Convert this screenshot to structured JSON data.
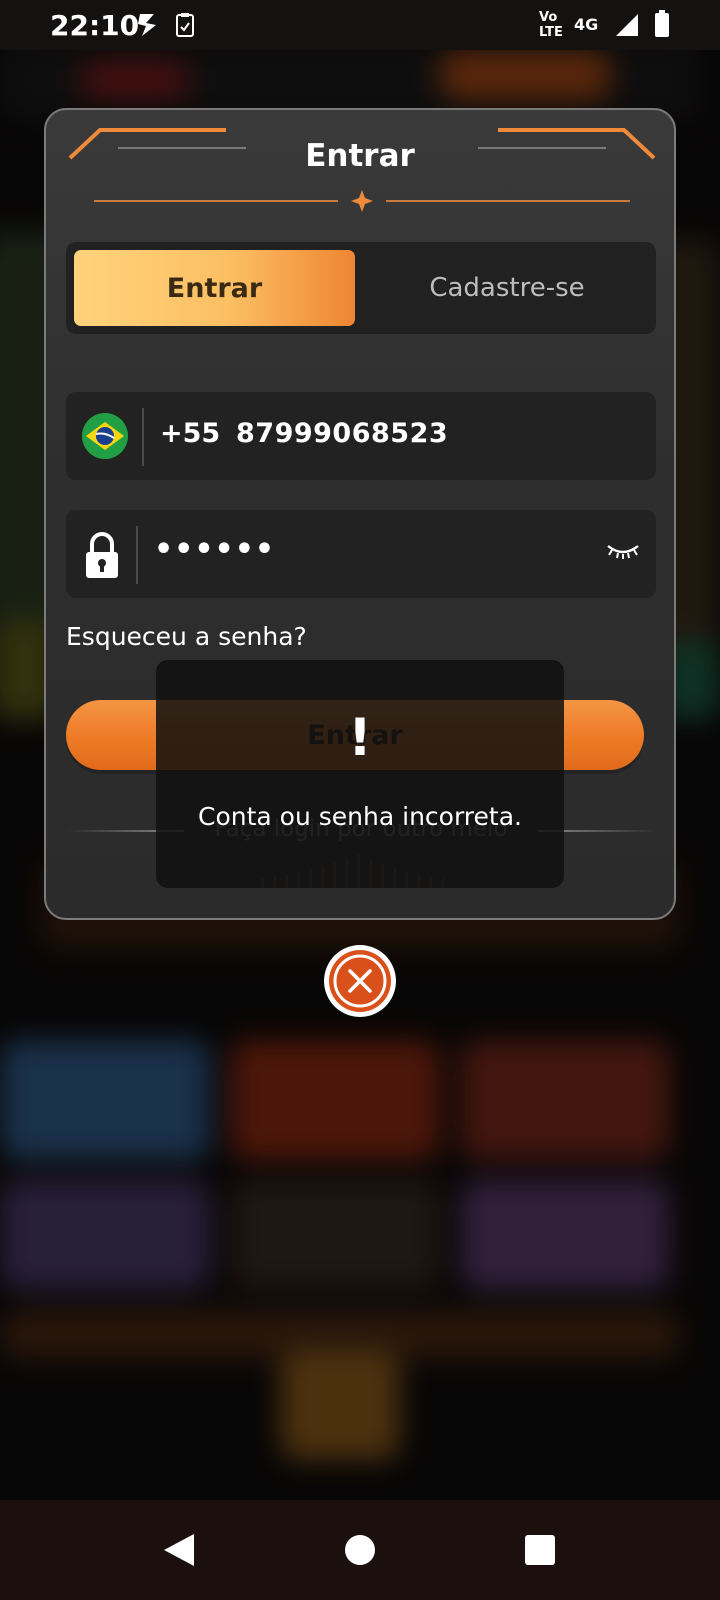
{
  "status_bar": {
    "time": "22:10",
    "network_label": "4G",
    "volte_label_top": "Vo",
    "volte_label_bottom": "LTE",
    "icons": [
      "app-s-icon",
      "clipboard-check-icon",
      "volte-icon",
      "signal-icon",
      "battery-icon"
    ]
  },
  "modal": {
    "title": "Entrar",
    "tabs": [
      {
        "label": "Entrar",
        "active": true
      },
      {
        "label": "Cadastre-se",
        "active": false
      }
    ],
    "phone": {
      "country_code": "+55",
      "number": "87999068523",
      "flag_icon": "brazil-flag-icon"
    },
    "password": {
      "masked_value": "••••••",
      "visibility_icon": "eye-closed-icon"
    },
    "forgot_password": "Esqueceu a senha?",
    "login_button": "Entrar",
    "other_login": "Faça login por outro meio"
  },
  "toast": {
    "icon": "!",
    "message": "Conta ou senha incorreta."
  },
  "close_button": {
    "icon": "close-icon"
  },
  "nav_bar": {
    "icons": [
      "back-icon",
      "home-icon",
      "recents-icon"
    ]
  },
  "colors": {
    "accent": "#ee7a26",
    "tab_gradient_start": "#ffd37c",
    "tab_gradient_end": "#ee8532",
    "modal_bg": "#333333",
    "close_bg": "#d9501b"
  }
}
